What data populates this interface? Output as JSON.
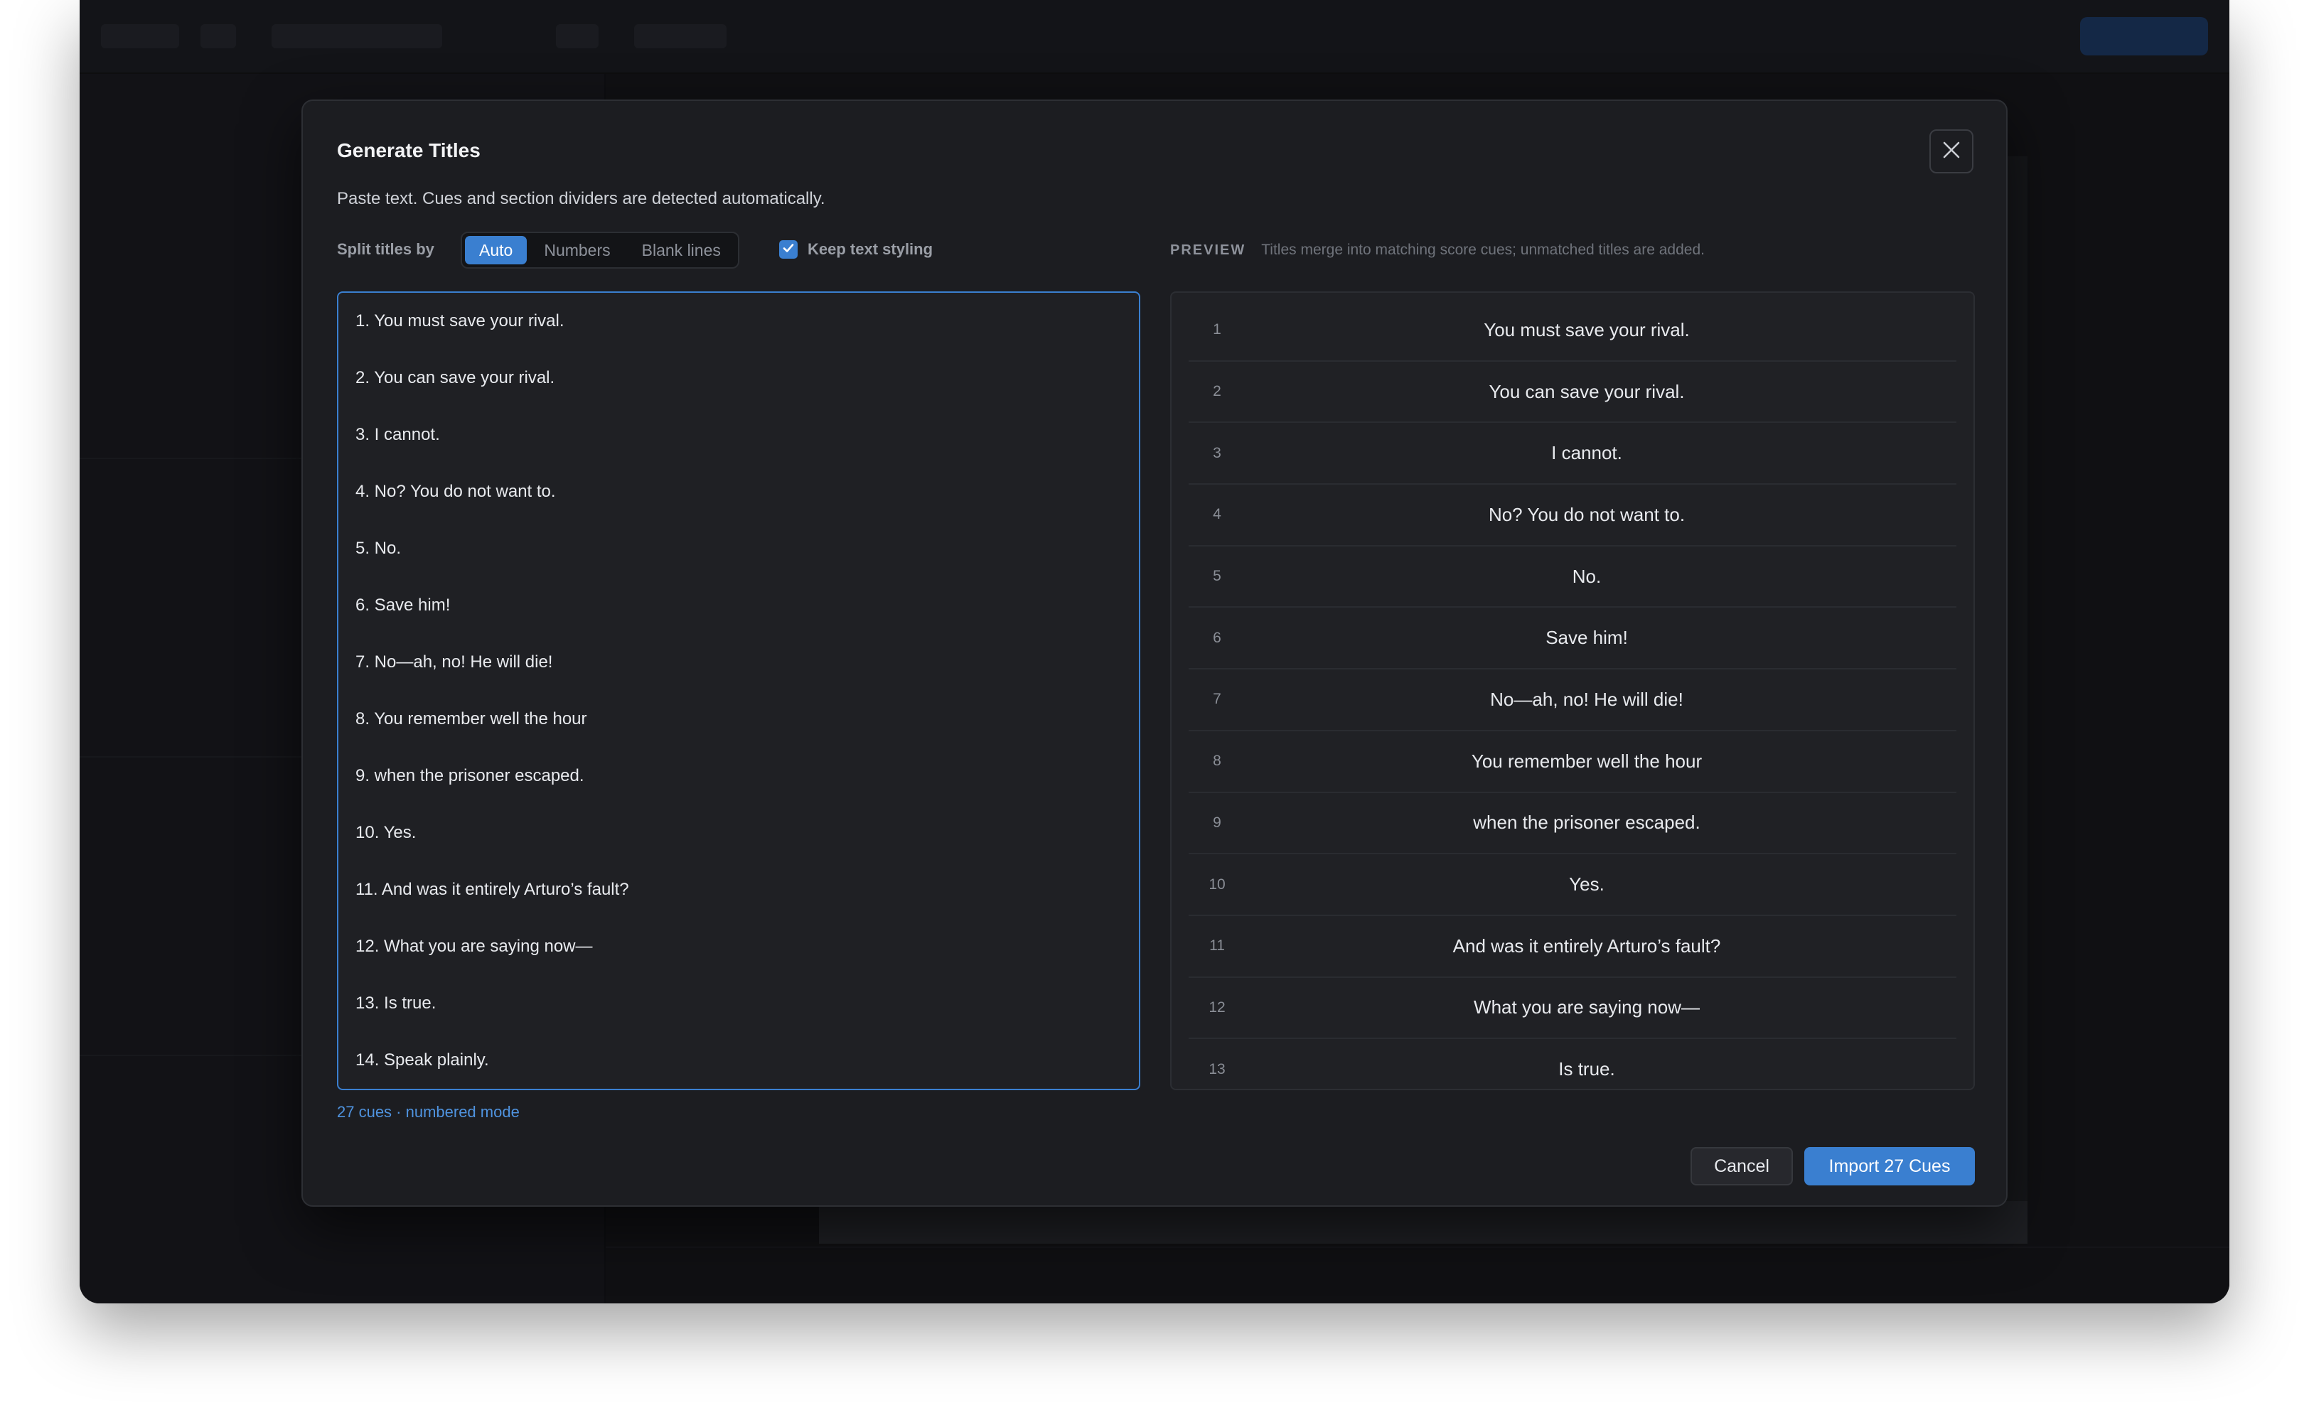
{
  "modal": {
    "title": "Generate Titles",
    "description": "Paste text. Cues and section dividers are detected automatically.",
    "split_label": "Split titles by",
    "split_options": [
      "Auto",
      "Numbers",
      "Blank lines"
    ],
    "split_selected": "Auto",
    "keep_styling_label": "Keep text styling",
    "keep_styling_checked": true,
    "preview_title": "PREVIEW",
    "preview_hint": "Titles merge into matching score cues; unmatched titles are added.",
    "editor_lines": [
      "1. You must save your rival.",
      "2. You can save your rival.",
      "3. I cannot.",
      "4. No? You do not want to.",
      "5. No.",
      "6. Save him!",
      "7. No—ah, no! He will die!",
      "8. You remember well the hour",
      "9. when the prisoner escaped.",
      "10. Yes.",
      "11. And was it entirely Arturo’s fault?",
      "12. What you are saying now—",
      "13. Is true.",
      "14. Speak plainly."
    ],
    "cue_count_text": "27 cues · numbered mode",
    "preview_rows": [
      {
        "num": "1",
        "text": "You must save your rival."
      },
      {
        "num": "2",
        "text": "You can save your rival."
      },
      {
        "num": "3",
        "text": "I cannot."
      },
      {
        "num": "4",
        "text": "No? You do not want to."
      },
      {
        "num": "5",
        "text": "No."
      },
      {
        "num": "6",
        "text": "Save him!"
      },
      {
        "num": "7",
        "text": "No—ah, no! He will die!"
      },
      {
        "num": "8",
        "text": "You remember well the hour"
      },
      {
        "num": "9",
        "text": "when the prisoner escaped."
      },
      {
        "num": "10",
        "text": "Yes."
      },
      {
        "num": "11",
        "text": "And was it entirely Arturo’s fault?"
      },
      {
        "num": "12",
        "text": "What you are saying now—"
      },
      {
        "num": "13",
        "text": "Is true."
      }
    ],
    "cancel_label": "Cancel",
    "import_label": "Import 27 Cues",
    "icons": {
      "close": "close-icon",
      "check": "checkmark-icon"
    },
    "colors": {
      "accent": "#3a7fd0",
      "background": "#1c1d21"
    }
  }
}
